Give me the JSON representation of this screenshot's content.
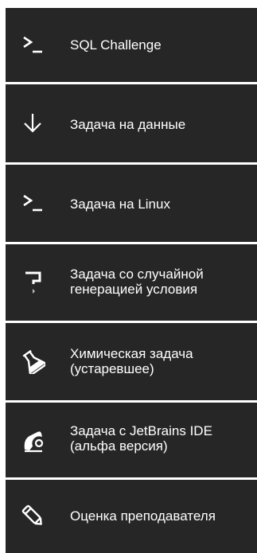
{
  "menu": {
    "items": [
      {
        "label": "SQL Challenge",
        "icon": "terminal-icon"
      },
      {
        "label": "Задача на данные",
        "icon": "arrow-down-icon"
      },
      {
        "label": "Задача на Linux",
        "icon": "terminal-icon"
      },
      {
        "label": "Задача со случайной\nгенерацией условия",
        "icon": "random-generation-icon"
      },
      {
        "label": "Химическая задача\n(устаревшее)",
        "icon": "flask-icon"
      },
      {
        "label": "Задача с JetBrains IDE\n(альфа версия)",
        "icon": "jetbrains-ide-icon"
      },
      {
        "label": "Оценка преподавателя",
        "icon": "pencil-icon"
      }
    ]
  }
}
